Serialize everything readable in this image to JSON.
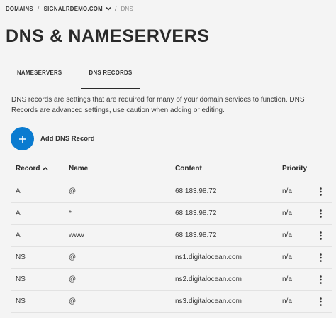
{
  "breadcrumb": {
    "domains": "DOMAINS",
    "separator": "/",
    "domain": "SIGNALRDEMO.COM",
    "current": "DNS"
  },
  "page_title": "DNS & NAMESERVERS",
  "tabs": [
    {
      "label": "NAMESERVERS",
      "active": false
    },
    {
      "label": "DNS RECORDS",
      "active": true
    }
  ],
  "description": "DNS records are settings that are required for many of your domain services to function. DNS Records are advanced settings, use caution when adding or editing.",
  "add_record": {
    "label": "Add DNS Record",
    "icon": "plus-icon",
    "color": "#0a7bd0"
  },
  "table": {
    "headers": {
      "record": "Record",
      "name": "Name",
      "content": "Content",
      "priority": "Priority"
    },
    "sort_icon": "chevron-up-icon",
    "rows": [
      {
        "record": "A",
        "name": "@",
        "content": "68.183.98.72",
        "priority": "n/a"
      },
      {
        "record": "A",
        "name": "*",
        "content": "68.183.98.72",
        "priority": "n/a"
      },
      {
        "record": "A",
        "name": "www",
        "content": "68.183.98.72",
        "priority": "n/a"
      },
      {
        "record": "NS",
        "name": "@",
        "content": "ns1.digitalocean.com",
        "priority": "n/a"
      },
      {
        "record": "NS",
        "name": "@",
        "content": "ns2.digitalocean.com",
        "priority": "n/a"
      },
      {
        "record": "NS",
        "name": "@",
        "content": "ns3.digitalocean.com",
        "priority": "n/a"
      }
    ]
  }
}
